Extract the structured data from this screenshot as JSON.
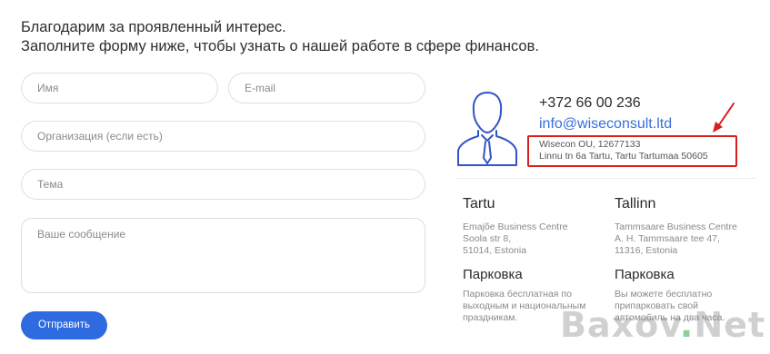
{
  "intro": {
    "line1": "Благодарим за проявленный интерес.",
    "line2": "Заполните форму ниже, чтобы узнать о нашей работе в сфере финансов."
  },
  "form": {
    "name_placeholder": "Имя",
    "email_placeholder": "E-mail",
    "org_placeholder": "Организация (если есть)",
    "subject_placeholder": "Тема",
    "message_placeholder": "Ваше сообщение",
    "send_label": "Отправить",
    "button_color": "#2e6ae0"
  },
  "contact": {
    "avatar_icon": "person-icon",
    "phone": "+372 66 00 236",
    "email": "info@wiseconsult.ltd",
    "company_line1": "Wisecon OU, 12677133",
    "company_line2": "Linnu tn 6a Tartu, Tartu Tartumaa 50605",
    "highlight_color": "#d81f1f",
    "link_color": "#3a6fd8"
  },
  "offices": [
    {
      "city": "Tartu",
      "address": [
        "Emajõe Business Centre",
        "Soola str 8,",
        "51014, Estonia"
      ],
      "parking_title": "Парковка",
      "parking_text": [
        "Парковка бесплатная по",
        "выходным и национальным",
        "праздникам."
      ]
    },
    {
      "city": "Tallinn",
      "address": [
        "Tammsaare Business Centre",
        "A. H. Tammsaare tee 47,",
        "11316, Estonia"
      ],
      "parking_title": "Парковка",
      "parking_text": [
        "Вы можете бесплатно",
        "припарковать свой",
        "автомобиль на два часа."
      ]
    }
  ],
  "watermark": {
    "part1": "Baxov",
    "dot": ".",
    "part2": "Net"
  }
}
